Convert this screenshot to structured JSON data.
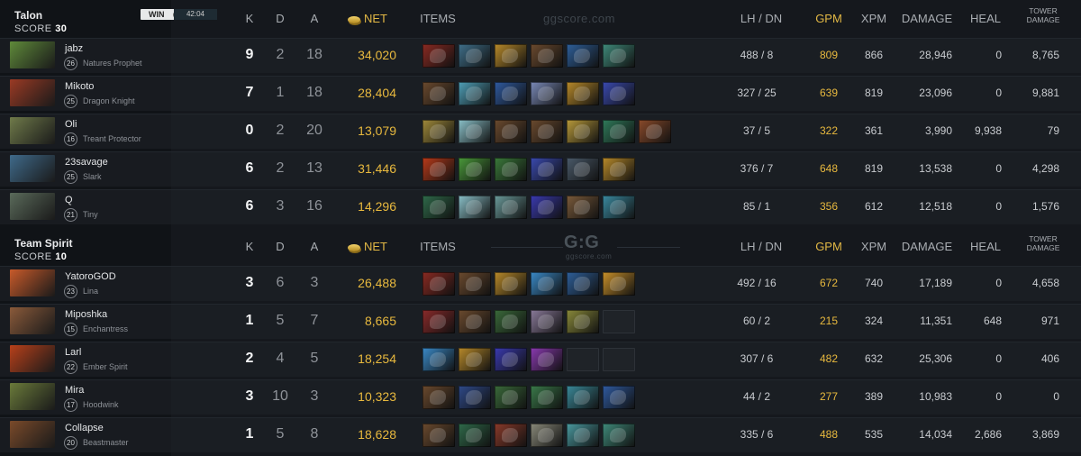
{
  "columns": {
    "k": "K",
    "d": "D",
    "a": "A",
    "net": "NET",
    "items": "ITEMS",
    "lhdn": "LH / DN",
    "gpm": "GPM",
    "xpm": "XPM",
    "damage": "DAMAGE",
    "heal": "HEAL",
    "tower_line1": "TOWER",
    "tower_line2": "DAMAGE"
  },
  "watermark": {
    "top": "ggscore.com",
    "logo": "G:G",
    "sub": "ggscore.com"
  },
  "match": {
    "result": "WIN",
    "duration": "42:04"
  },
  "teams": [
    {
      "name": "Talon",
      "score_label": "SCORE",
      "score": "30",
      "players": [
        {
          "name": "jabz",
          "level": "26",
          "hero": "Natures Prophet",
          "portrait_color": "#5f8a3a",
          "k": "9",
          "d": "2",
          "a": "18",
          "net": "34,020",
          "lhdn": "488  /  8",
          "gpm": "809",
          "xpm": "866",
          "damage": "28,946",
          "heal": "0",
          "tower": "8,765",
          "items": [
            "#8a2a22",
            "#3f6f8a",
            "#b88a2a",
            "#6b4a2e",
            "#2e5f9a",
            "#3f8a7a"
          ]
        },
        {
          "name": "Mikoto",
          "level": "25",
          "hero": "Dragon Knight",
          "portrait_color": "#9a3a24",
          "k": "7",
          "d": "1",
          "a": "18",
          "net": "28,404",
          "lhdn": "327  /  25",
          "gpm": "639",
          "xpm": "819",
          "damage": "23,096",
          "heal": "0",
          "tower": "9,881",
          "items": [
            "#6b4a2e",
            "#4fa0b8",
            "#2f5aa0",
            "#7a8ab8",
            "#b88a2a",
            "#3a4ab0"
          ]
        },
        {
          "name": "Oli",
          "level": "16",
          "hero": "Treant Protector",
          "portrait_color": "#6f7a4a",
          "k": "0",
          "d": "2",
          "a": "20",
          "net": "13,079",
          "lhdn": "37  /  5",
          "gpm": "322",
          "xpm": "361",
          "damage": "3,990",
          "heal": "9,938",
          "tower": "79",
          "items": [
            "#a08a3a",
            "#8ac0c8",
            "#6b4a2e",
            "#6b4a2e",
            "#b89a3a",
            "#2f7a5a",
            "#8a4a2a"
          ]
        },
        {
          "name": "23savage",
          "level": "25",
          "hero": "Slark",
          "portrait_color": "#3f6a8a",
          "k": "6",
          "d": "2",
          "a": "13",
          "net": "31,446",
          "lhdn": "376  /  7",
          "gpm": "648",
          "xpm": "819",
          "damage": "13,538",
          "heal": "0",
          "tower": "4,298",
          "items": [
            "#b83a1a",
            "#4a9a3a",
            "#3a7a3a",
            "#3a4ab0",
            "#4a5a6a",
            "#b88a2a"
          ]
        },
        {
          "name": "Q",
          "level": "21",
          "hero": "Tiny",
          "portrait_color": "#5a6a5a",
          "k": "6",
          "d": "3",
          "a": "16",
          "net": "14,296",
          "lhdn": "85  /  1",
          "gpm": "356",
          "xpm": "612",
          "damage": "12,518",
          "heal": "0",
          "tower": "1,576",
          "items": [
            "#2f6a4a",
            "#8ac0c8",
            "#6a9a9a",
            "#3a3ab0",
            "#7a5a3a",
            "#3a8aa0"
          ]
        }
      ]
    },
    {
      "name": "Team Spirit",
      "score_label": "SCORE",
      "score": "10",
      "players": [
        {
          "name": "YatoroGOD",
          "level": "23",
          "hero": "Lina",
          "portrait_color": "#c85a2a",
          "k": "3",
          "d": "6",
          "a": "3",
          "net": "26,488",
          "lhdn": "492  /  16",
          "gpm": "672",
          "xpm": "740",
          "damage": "17,189",
          "heal": "0",
          "tower": "4,658",
          "items": [
            "#8a2a22",
            "#6b4a2e",
            "#b88a2a",
            "#3a8ac8",
            "#2e5f9a",
            "#c8902a"
          ]
        },
        {
          "name": "Miposhka",
          "level": "15",
          "hero": "Enchantress",
          "portrait_color": "#8a5a3a",
          "k": "1",
          "d": "5",
          "a": "7",
          "net": "8,665",
          "lhdn": "60  /  2",
          "gpm": "215",
          "xpm": "324",
          "damage": "11,351",
          "heal": "648",
          "tower": "971",
          "items": [
            "#8a2a2a",
            "#6b4a2e",
            "#3a6a3a",
            "#8a7a9a",
            "#8a8a3a",
            "empty"
          ]
        },
        {
          "name": "Larl",
          "level": "22",
          "hero": "Ember Spirit",
          "portrait_color": "#b8401a",
          "k": "2",
          "d": "4",
          "a": "5",
          "net": "18,254",
          "lhdn": "307  /  6",
          "gpm": "482",
          "xpm": "632",
          "damage": "25,306",
          "heal": "0",
          "tower": "406",
          "items": [
            "#3a8ac8",
            "#b88a2a",
            "#3a3ab0",
            "#8a3ab0",
            "empty",
            "empty"
          ]
        },
        {
          "name": "Mira",
          "level": "17",
          "hero": "Hoodwink",
          "portrait_color": "#6a7a3a",
          "k": "3",
          "d": "10",
          "a": "3",
          "net": "10,323",
          "lhdn": "44  /  2",
          "gpm": "277",
          "xpm": "389",
          "damage": "10,983",
          "heal": "0",
          "tower": "0",
          "items": [
            "#6b4a2e",
            "#2f4a8a",
            "#3a6a3a",
            "#3a7a4a",
            "#3a8a9a",
            "#2f5aa0"
          ]
        },
        {
          "name": "Collapse",
          "level": "20",
          "hero": "Beastmaster",
          "portrait_color": "#7a4a2a",
          "k": "1",
          "d": "5",
          "a": "8",
          "net": "18,628",
          "lhdn": "335  /  6",
          "gpm": "488",
          "xpm": "535",
          "damage": "14,034",
          "heal": "2,686",
          "tower": "3,869",
          "items": [
            "#6b4a2e",
            "#2f6a4a",
            "#8a3a2a",
            "#8a8a7a",
            "#4a9aa0",
            "#3f8a7a"
          ]
        }
      ]
    }
  ]
}
